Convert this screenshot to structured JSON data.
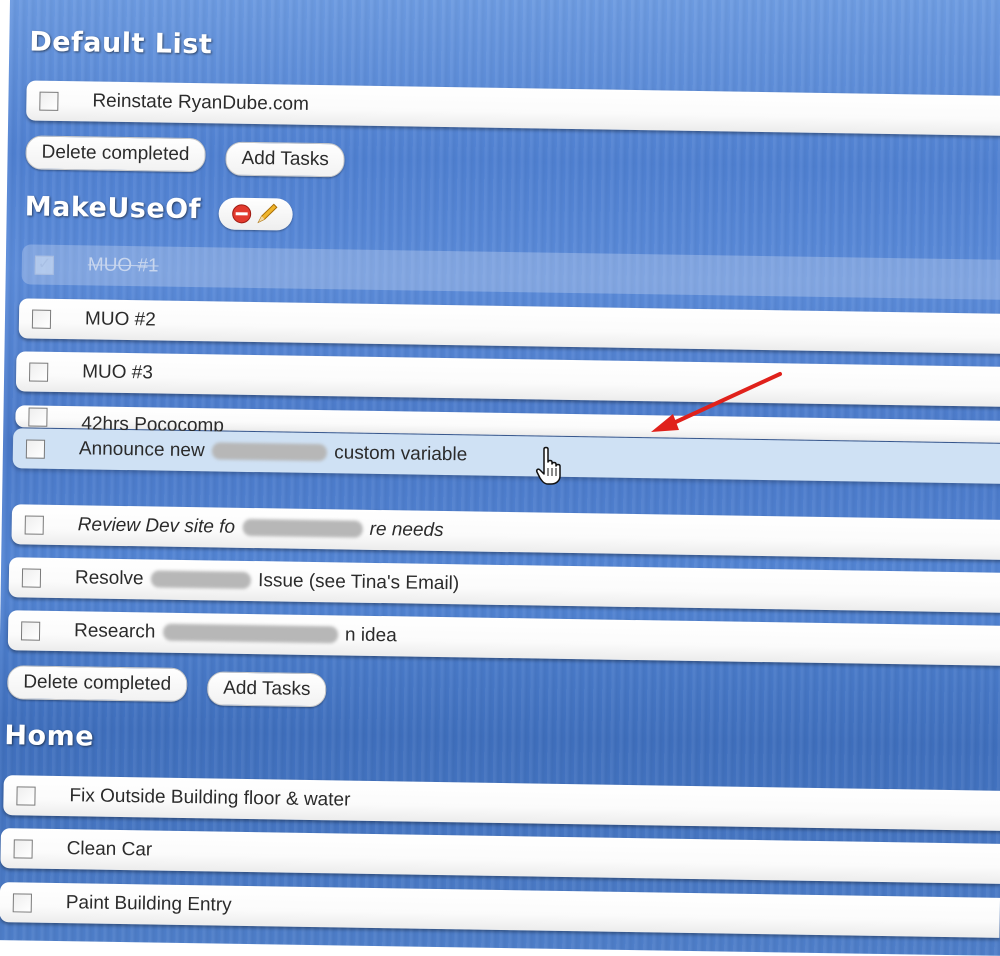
{
  "lists": [
    {
      "title": "Default List",
      "tasks": [
        "Reinstate RyanDube.com"
      ],
      "delete_label": "Delete completed",
      "add_label": "Add Tasks"
    },
    {
      "title": "MakeUseOf",
      "tasks": [
        "MUO #1",
        "MUO #2",
        "MUO #3",
        "42hrs Pococomp",
        "Announce new",
        "custom variable",
        "Review Dev site fo",
        "re needs",
        "Resolve",
        "Issue (see Tina's Email)",
        "Research",
        "n idea"
      ],
      "delete_label": "Delete completed",
      "add_label": "Add Tasks"
    },
    {
      "title": "Home",
      "tasks": [
        "Fix Outside Building floor & water",
        "Clean Car",
        "Paint Building Entry"
      ]
    }
  ],
  "task_states": {
    "MUO #1": "completed"
  },
  "icons": {
    "delete_list": "minus-circle-icon",
    "edit_list": "pencil-icon",
    "cursor": "hand-cursor-icon",
    "arrow": "red-arrow"
  },
  "colors": {
    "background": "#4f80d1",
    "task_bg": "#ffffff",
    "drag_bg": "#cfe1f4",
    "arrow": "#e0211b"
  }
}
